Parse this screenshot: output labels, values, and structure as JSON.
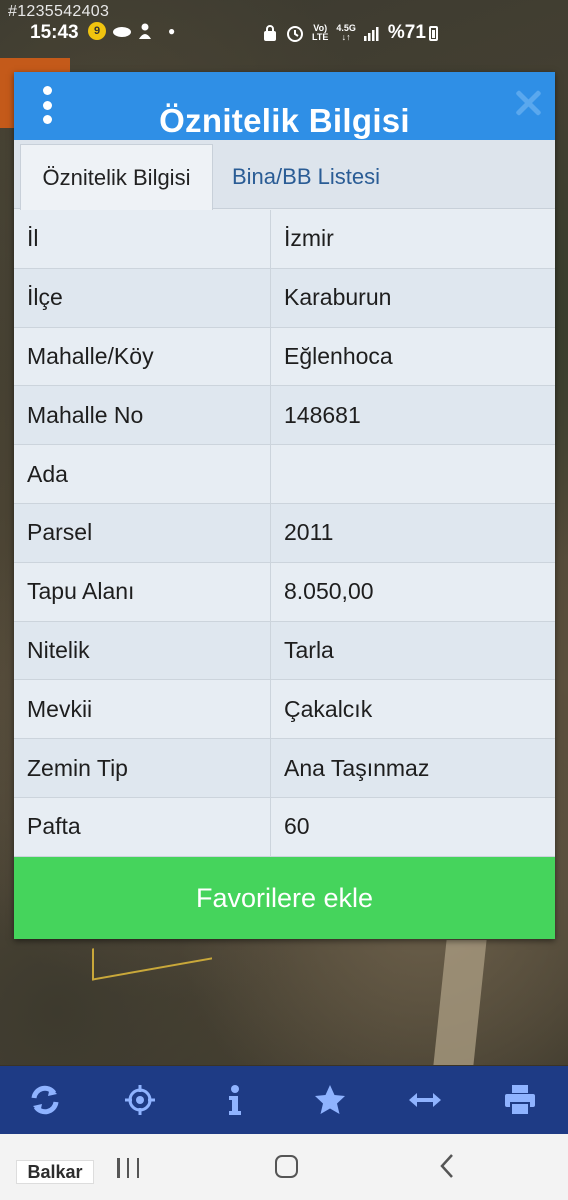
{
  "watermark_id": "#1235542403",
  "status_bar": {
    "time": "15:43",
    "notif_badge": "9",
    "network_top": "Vo)",
    "network_bottom": "LTE",
    "net_speed": "4.5G",
    "battery": "%71"
  },
  "dialog": {
    "title": "Öznitelik Bilgisi",
    "tabs": [
      {
        "label": "Öznitelik Bilgisi",
        "active": true
      },
      {
        "label": "Bina/BB Listesi",
        "active": false
      }
    ],
    "rows": [
      {
        "key": "İl",
        "value": "İzmir"
      },
      {
        "key": "İlçe",
        "value": "Karaburun"
      },
      {
        "key": "Mahalle/Köy",
        "value": "Eğlenhoca"
      },
      {
        "key": "Mahalle No",
        "value": "148681"
      },
      {
        "key": "Ada",
        "value": ""
      },
      {
        "key": "Parsel",
        "value": "2011"
      },
      {
        "key": "Tapu Alanı",
        "value": "8.050,00"
      },
      {
        "key": "Nitelik",
        "value": "Tarla"
      },
      {
        "key": "Mevkii",
        "value": "Çakalcık"
      },
      {
        "key": "Zemin Tip",
        "value": "Ana Taşınmaz"
      },
      {
        "key": "Pafta",
        "value": "60"
      }
    ],
    "favorite_button": "Favorilere ekle"
  },
  "toolbar": {
    "tools": [
      "refresh-icon",
      "locate-icon",
      "info-icon",
      "star-icon",
      "measure-icon",
      "print-icon"
    ]
  },
  "brand": "Balkar",
  "colors": {
    "header_blue": "#2f8fe6",
    "favorite_green": "#45d45c",
    "toolbar_blue": "#1e3b85"
  }
}
